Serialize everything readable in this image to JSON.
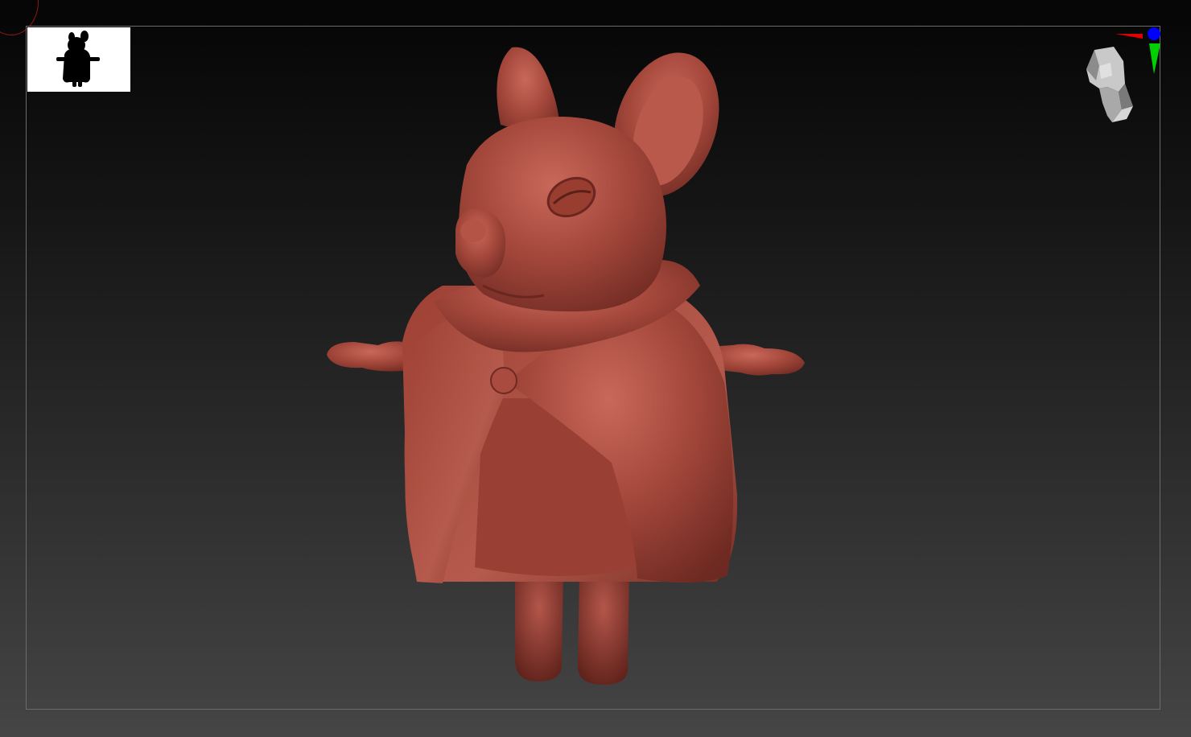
{
  "app": {
    "type": "3d-sculpt-viewport"
  },
  "scene": {
    "model_name": "",
    "material_color": "#a4473b",
    "background_top": "#050505",
    "background_bottom": "#454545",
    "frame_color": "#6b6b6b"
  },
  "thumbnail": {
    "background": "#ffffff",
    "silhouette_color": "#000000"
  },
  "navigation": {
    "cube_icon": "head-nav-icon",
    "gizmo_icon": "axis-gizmo-icon",
    "axis_colors": {
      "x": "#e00000",
      "y": "#00d000",
      "z": "#0000ff"
    }
  }
}
